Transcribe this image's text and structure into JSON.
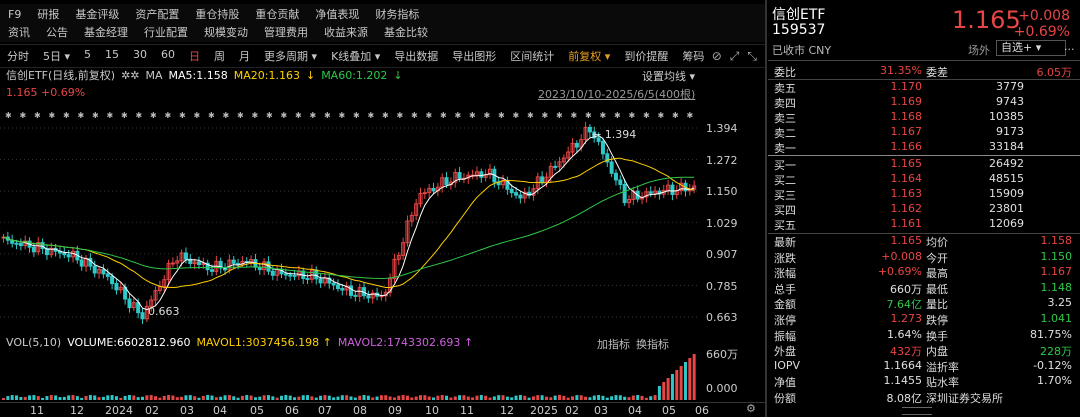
{
  "top_menu": [
    "F9",
    "研报",
    "基金评级",
    "资产配置",
    "重仓持股",
    "重仓贡献",
    "净值表现",
    "财务指标"
  ],
  "top_menu2": [
    "资讯",
    "公告",
    "基金经理",
    "行业配置",
    "规模变动",
    "管理费用",
    "收益来源",
    "基金比较"
  ],
  "toolbar": {
    "items": [
      "分时",
      "5日",
      "5",
      "15",
      "30",
      "60",
      "日",
      "周",
      "月",
      "更多周期",
      "K线叠加",
      "导出数据",
      "导出图形",
      "区间统计",
      "前复权",
      "到价提醒",
      "筹码"
    ],
    "active": "日",
    "special": "前复权"
  },
  "chart_header": {
    "title": "信创ETF(日线,前复权)",
    "ma_label": "MA",
    "ma5": "MA5:1.158",
    "ma20": "MA20:1.163",
    "ma60": "MA60:1.202",
    "settings": "设置均线",
    "price_line": "1.165 +0.69%",
    "range": "2023/10/10-2025/6/5(400根)",
    "high_label": "1.394",
    "low_label": "0.663"
  },
  "y_ticks": [
    "1.394",
    "1.272",
    "1.150",
    "1.029",
    "0.907",
    "0.785",
    "0.663"
  ],
  "volume": {
    "label": "VOL(5,10)",
    "volume": "VOLUME:6602812.960",
    "mavol1": "MAVOL1:3037456.198",
    "mavol2": "MAVOL2:1743302.693",
    "add_indicator": "加指标",
    "switch_indicator": "换指标",
    "y_top": "660万",
    "y_bottom": "0.000"
  },
  "x_ticks": [
    "11",
    "12",
    "2024",
    "02",
    "03",
    "04",
    "05",
    "06",
    "07",
    "08",
    "09",
    "10",
    "11",
    "12",
    "2025",
    "02",
    "03",
    "04",
    "05",
    "06"
  ],
  "quote": {
    "name": "信创ETF",
    "code": "159537",
    "market": "已收市 CNY",
    "price": "1.165",
    "change": "+0.008",
    "change_pct": "+0.69%",
    "otc": "场外",
    "select": "自选+",
    "more": "...",
    "webi_label": "委比",
    "webi_val": "31.35%",
    "weicha_label": "委差",
    "weicha_val": "6.05万",
    "asks": [
      {
        "label": "卖五",
        "price": "1.170",
        "vol": "3779"
      },
      {
        "label": "卖四",
        "price": "1.169",
        "vol": "9743"
      },
      {
        "label": "卖三",
        "price": "1.168",
        "vol": "10385"
      },
      {
        "label": "卖二",
        "price": "1.167",
        "vol": "9173"
      },
      {
        "label": "卖一",
        "price": "1.166",
        "vol": "33184"
      }
    ],
    "bids": [
      {
        "label": "买一",
        "price": "1.165",
        "vol": "26492"
      },
      {
        "label": "买二",
        "price": "1.164",
        "vol": "48515"
      },
      {
        "label": "买三",
        "price": "1.163",
        "vol": "15909"
      },
      {
        "label": "买四",
        "price": "1.162",
        "vol": "23801"
      },
      {
        "label": "买五",
        "price": "1.161",
        "vol": "12069"
      }
    ],
    "stats": [
      {
        "l1": "最新",
        "v1": "1.165",
        "c1": "red",
        "l2": "均价",
        "v2": "1.158",
        "c2": "red"
      },
      {
        "l1": "涨跌",
        "v1": "+0.008",
        "c1": "red",
        "l2": "今开",
        "v2": "1.150",
        "c2": "green"
      },
      {
        "l1": "涨幅",
        "v1": "+0.69%",
        "c1": "red",
        "l2": "最高",
        "v2": "1.167",
        "c2": "red"
      },
      {
        "l1": "总手",
        "v1": "660万",
        "c1": "white",
        "l2": "最低",
        "v2": "1.148",
        "c2": "green"
      },
      {
        "l1": "金额",
        "v1": "7.64亿",
        "c1": "green",
        "l2": "量比",
        "v2": "3.25",
        "c2": "white"
      },
      {
        "l1": "涨停",
        "v1": "1.273",
        "c1": "red",
        "l2": "跌停",
        "v2": "1.041",
        "c2": "green"
      },
      {
        "l1": "振幅",
        "v1": "1.64%",
        "c1": "white",
        "l2": "换手",
        "v2": "81.75%",
        "c2": "white"
      },
      {
        "l1": "外盘",
        "v1": "432万",
        "c1": "red",
        "l2": "内盘",
        "v2": "228万",
        "c2": "green"
      },
      {
        "l1": "IOPV",
        "v1": "1.1664",
        "c1": "white",
        "l2": "溢折率",
        "v2": "-0.12%",
        "c2": "white"
      },
      {
        "l1": "净值",
        "v1": "1.1455",
        "c1": "white",
        "l2": "贴水率",
        "v2": "1.70%",
        "c2": "white"
      },
      {
        "l1": "份额",
        "v1": "8.08亿",
        "c1": "white",
        "l2": "深圳证券交易所",
        "v2": "",
        "c2": "white"
      }
    ]
  },
  "chart_data": {
    "type": "line",
    "title": "信创ETF(日线,前复权)",
    "x_range": [
      "2023/10/10",
      "2025/6/5"
    ],
    "ylim": [
      0.663,
      1.394
    ],
    "series": [
      {
        "name": "MA5",
        "value": 1.158
      },
      {
        "name": "MA20",
        "value": 1.163
      },
      {
        "name": "MA60",
        "value": 1.202
      }
    ],
    "close_path": [
      [
        "2023/10",
        0.96
      ],
      [
        "2023/11",
        0.93
      ],
      [
        "2023/12",
        0.9
      ],
      [
        "2024/01",
        0.82
      ],
      [
        "2024/02",
        0.663
      ],
      [
        "2024/03",
        0.9
      ],
      [
        "2024/04",
        0.85
      ],
      [
        "2024/05",
        0.88
      ],
      [
        "2024/06",
        0.83
      ],
      [
        "2024/07",
        0.82
      ],
      [
        "2024/08",
        0.76
      ],
      [
        "2024/09",
        0.74
      ],
      [
        "2024/10",
        1.13
      ],
      [
        "2024/11",
        1.2
      ],
      [
        "2024/12",
        1.22
      ],
      [
        "2025/01",
        1.12
      ],
      [
        "2025/02",
        1.25
      ],
      [
        "2025/03",
        1.394
      ],
      [
        "2025/04",
        1.12
      ],
      [
        "2025/05",
        1.15
      ],
      [
        "2025/06",
        1.165
      ]
    ],
    "colors": {
      "up": "#e84545",
      "down": "#2ec8c8",
      "ma5": "#ffffff",
      "ma20": "#ffd000",
      "ma60": "#2ec84a"
    }
  }
}
